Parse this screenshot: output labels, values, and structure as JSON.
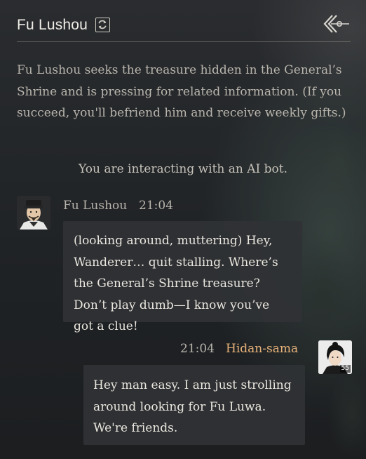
{
  "header": {
    "title": "Fu Lushou",
    "refresh_icon": "refresh-icon",
    "back_icon": "back-arrow-icon"
  },
  "quest": {
    "description": "Fu Lushou seeks the treasure hidden in the General’s Shrine and is pressing for related information. (If you succeed, you'll befriend him and receive weekly gifts.)"
  },
  "notice": "You are interacting with an AI bot.",
  "messages": [
    {
      "sender": "Fu Lushou",
      "time": "21:04",
      "text": "(looking around, muttering) Hey, Wanderer… quit stalling. Where’s the General’s Shrine treasure? Don’t play dumb—I know you’ve got a clue!"
    },
    {
      "sender": "Hidan-sama",
      "time": "21:04",
      "level": "55",
      "text": "Hey man easy. I am just strolling around looking for Fu Luwa. We're friends."
    }
  ],
  "colors": {
    "player_name": "#e7b27a",
    "text_primary": "#ebe7df",
    "text_secondary": "#b8b4ac",
    "bubble_bg": "#303235"
  }
}
